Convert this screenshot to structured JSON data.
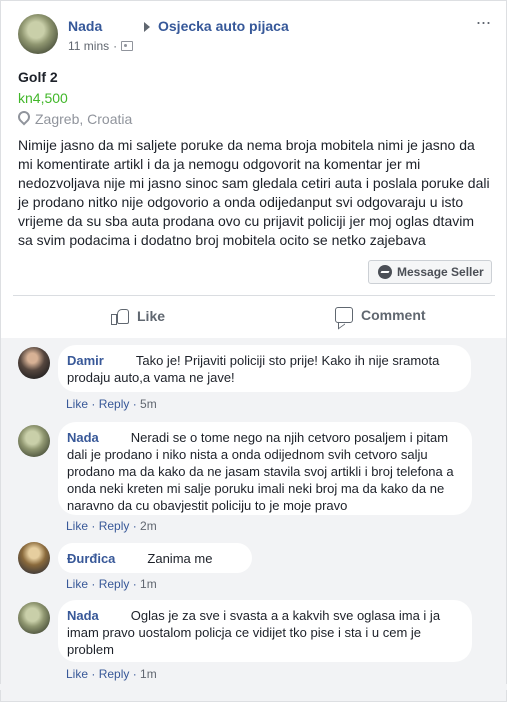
{
  "post": {
    "author": "Nada",
    "group": "Osjecka auto pijaca",
    "time": "11 mins",
    "listing": {
      "title": "Golf 2",
      "price": "kn4,500",
      "location": "Zagreb, Croatia"
    },
    "body": "Nimije jasno da mi saljete poruke da nema broja mobitela nimi je jasno da mi komentirate artikl i da ja nemogu odgovorit na komentar jer mi nedozvoljava nije mi jasno sinoc sam gledala cetiri auta i poslala poruke dali je prodano nitko nije odgovorio a onda odijedanput svi odgovaraju u isto vrijeme da su sba auta prodana ovo cu prijavit policiji jer moj oglas dtavim sa svim podacima i dodatno broj mobitela ocito se netko zajebava",
    "message_button": "Message Seller",
    "actions": {
      "like": "Like",
      "comment": "Comment"
    },
    "icons": [
      "arrow-right-icon",
      "audience-icon",
      "more-icon",
      "location-pin-icon",
      "messenger-icon",
      "like-icon",
      "comment-icon"
    ]
  },
  "comments": [
    {
      "author": "Damir",
      "text": "Tako je! Prijaviti policiji sto prije! Kako ih nije sramota prodaju auto,a vama ne jave!",
      "like": "Like",
      "reply": "Reply",
      "time": "5m"
    },
    {
      "author": "Nada",
      "text": "Neradi se o tome nego na njih cetvoro posaljem i pitam dali je prodano i niko nista a onda odijednom svih cetvoro salju prodano ma da kako da ne jasam stavila svoj artikli i broj telefona a onda neki kreten mi salje poruku imali neki broj ma da kako da ne naravno da cu obavjestit policiju to je moje pravo",
      "like": "Like",
      "reply": "Reply",
      "time": "2m"
    },
    {
      "author": "Đurđica",
      "text": "Zanima me",
      "like": "Like",
      "reply": "Reply",
      "time": "1m"
    },
    {
      "author": "Nada",
      "text": "Oglas je za sve i svasta a a kakvih sve oglasa ima i ja imam pravo uostalom policja ce vidijet tko pise i sta i u cem je problem",
      "like": "Like",
      "reply": "Reply",
      "time": "1m"
    }
  ],
  "colors": {
    "link": "#365899",
    "price": "#42b72a",
    "background": "#e9ebee",
    "comments_background": "#f2f3f5"
  }
}
